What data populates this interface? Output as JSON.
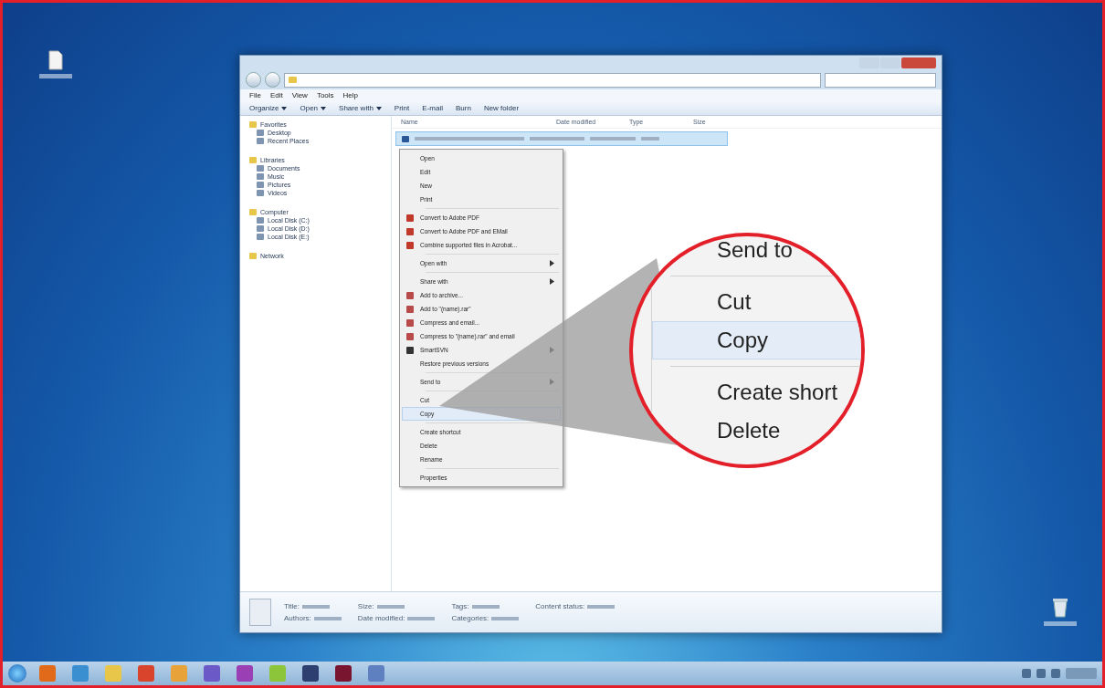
{
  "desktop_icons": [
    {
      "kind": "file"
    },
    {
      "kind": "recycle-bin"
    }
  ],
  "window": {
    "menu": [
      "File",
      "Edit",
      "View",
      "Tools",
      "Help"
    ],
    "toolbar": [
      {
        "label": "Organize",
        "dropdown": true
      },
      {
        "label": "Open",
        "dropdown": true
      },
      {
        "label": "Share with",
        "dropdown": true
      },
      {
        "label": "Print",
        "dropdown": false
      },
      {
        "label": "E-mail",
        "dropdown": false
      },
      {
        "label": "Burn",
        "dropdown": false
      },
      {
        "label": "New folder",
        "dropdown": false
      }
    ],
    "sidebar": [
      {
        "label": "Favorites",
        "children": [
          {
            "label": "Desktop"
          },
          {
            "label": "Recent Places"
          }
        ]
      },
      {
        "label": "Libraries",
        "children": [
          {
            "label": "Documents"
          },
          {
            "label": "Music"
          },
          {
            "label": "Pictures"
          },
          {
            "label": "Videos"
          }
        ]
      },
      {
        "label": "Computer",
        "children": [
          {
            "label": "Local Disk (C:)"
          },
          {
            "label": "Local Disk (D:)"
          },
          {
            "label": "Local Disk (E:)"
          }
        ]
      },
      {
        "label": "Network"
      }
    ],
    "columns": [
      "Name",
      "Date modified",
      "Type",
      "Size"
    ],
    "files": [
      {
        "selected": true
      }
    ]
  },
  "context_menu": {
    "items": [
      {
        "kind": "item",
        "label": "Open",
        "submenu": false,
        "selected": false
      },
      {
        "kind": "item",
        "label": "Edit",
        "submenu": false,
        "selected": false
      },
      {
        "kind": "item",
        "label": "New",
        "submenu": false,
        "selected": false
      },
      {
        "kind": "item",
        "label": "Print",
        "submenu": false,
        "selected": false
      },
      {
        "kind": "separator"
      },
      {
        "kind": "pdf",
        "label": "Convert to Adobe PDF",
        "submenu": false,
        "selected": false
      },
      {
        "kind": "pdf",
        "label": "Convert to Adobe PDF and EMail",
        "submenu": false,
        "selected": false
      },
      {
        "kind": "pdf",
        "label": "Combine supported files in Acrobat...",
        "submenu": false,
        "selected": false
      },
      {
        "kind": "separator"
      },
      {
        "kind": "item",
        "label": "Open with",
        "submenu": true,
        "selected": false
      },
      {
        "kind": "separator"
      },
      {
        "kind": "item",
        "label": "Share with",
        "submenu": true,
        "selected": false
      },
      {
        "kind": "archive",
        "label": "Add to archive...",
        "submenu": false,
        "selected": false
      },
      {
        "kind": "archive",
        "label": "Add to \"(name).rar\"",
        "submenu": false,
        "selected": false
      },
      {
        "kind": "archive",
        "label": "Compress and email...",
        "submenu": false,
        "selected": false
      },
      {
        "kind": "archive",
        "label": "Compress to \"(name).rar\" and email",
        "submenu": false,
        "selected": false
      },
      {
        "kind": "app",
        "label": "SmartSVN",
        "submenu": true,
        "selected": false
      },
      {
        "kind": "item",
        "label": "Restore previous versions",
        "submenu": false,
        "selected": false
      },
      {
        "kind": "separator"
      },
      {
        "kind": "item",
        "label": "Send to",
        "submenu": true,
        "selected": false
      },
      {
        "kind": "separator"
      },
      {
        "kind": "item",
        "label": "Cut",
        "submenu": false,
        "selected": false
      },
      {
        "kind": "item",
        "label": "Copy",
        "submenu": false,
        "selected": true
      },
      {
        "kind": "separator"
      },
      {
        "kind": "item",
        "label": "Create shortcut",
        "submenu": false,
        "selected": false
      },
      {
        "kind": "item",
        "label": "Delete",
        "submenu": false,
        "selected": false
      },
      {
        "kind": "item",
        "label": "Rename",
        "submenu": false,
        "selected": false
      },
      {
        "kind": "separator"
      },
      {
        "kind": "item",
        "label": "Properties",
        "submenu": false,
        "selected": false
      }
    ]
  },
  "magnifier": {
    "items": [
      {
        "kind": "item",
        "label": "Send to",
        "selected": false
      },
      {
        "kind": "separator"
      },
      {
        "kind": "item",
        "label": "Cut",
        "selected": false
      },
      {
        "kind": "item",
        "label": "Copy",
        "selected": true
      },
      {
        "kind": "separator"
      },
      {
        "kind": "item",
        "label": "Create short",
        "selected": false
      },
      {
        "kind": "item",
        "label": "Delete",
        "selected": false
      }
    ]
  },
  "details": {
    "fields": [
      "Title:",
      "Size:",
      "Tags:",
      "Content status:",
      "Authors:",
      "Date modified:",
      "Categories:"
    ]
  },
  "taskbar": {
    "apps": [
      {
        "color": "#e06a1a"
      },
      {
        "color": "#3a8fd0"
      },
      {
        "color": "#e8c64a"
      },
      {
        "color": "#d9442c"
      },
      {
        "color": "#e8a23a"
      },
      {
        "color": "#6b59c7"
      },
      {
        "color": "#9b3fb5"
      },
      {
        "color": "#8cc43a"
      },
      {
        "color": "#2d3f70"
      },
      {
        "color": "#7a1530"
      },
      {
        "color": "#5e7fc0"
      }
    ]
  }
}
